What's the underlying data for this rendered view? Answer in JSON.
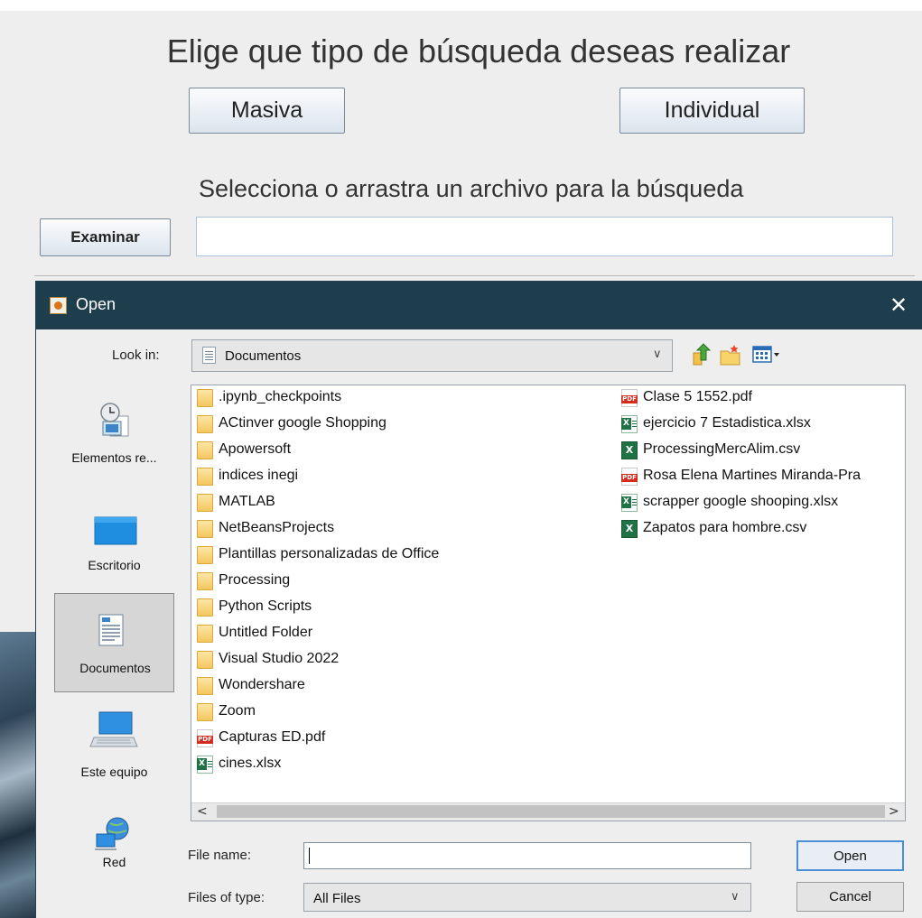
{
  "app": {
    "title": "Elige que tipo de búsqueda deseas realizar",
    "masiva_label": "Masiva",
    "individual_label": "Individual",
    "subtitle": "Selecciona o arrastra un archivo para la búsqueda",
    "examinar_label": "Examinar",
    "path_value": ""
  },
  "dialog": {
    "title": "Open",
    "close_glyph": "✕",
    "look_in_label": "Look in:",
    "look_in_value": "Documentos",
    "places": [
      {
        "label": "Elementos re...",
        "icon": "recent-items-icon"
      },
      {
        "label": "Escritorio",
        "icon": "desktop-icon"
      },
      {
        "label": "Documentos",
        "icon": "documents-icon",
        "selected": true
      },
      {
        "label": "Este equipo",
        "icon": "computer-icon"
      },
      {
        "label": "Red",
        "icon": "network-icon"
      }
    ],
    "files_col1": [
      {
        "name": ".ipynb_checkpoints",
        "type": "folder"
      },
      {
        "name": "ACtinver google Shopping",
        "type": "folder"
      },
      {
        "name": "Apowersoft",
        "type": "folder"
      },
      {
        "name": "indices inegi",
        "type": "folder"
      },
      {
        "name": "MATLAB",
        "type": "folder"
      },
      {
        "name": "NetBeansProjects",
        "type": "folder"
      },
      {
        "name": "Plantillas personalizadas de Office",
        "type": "folder"
      },
      {
        "name": "Processing",
        "type": "folder"
      },
      {
        "name": "Python Scripts",
        "type": "folder"
      },
      {
        "name": "Untitled Folder",
        "type": "folder"
      },
      {
        "name": "Visual Studio 2022",
        "type": "folder"
      },
      {
        "name": "Wondershare",
        "type": "folder"
      },
      {
        "name": "Zoom",
        "type": "folder"
      },
      {
        "name": "Capturas ED.pdf",
        "type": "pdf"
      },
      {
        "name": "cines.xlsx",
        "type": "xlsx"
      }
    ],
    "files_col2": [
      {
        "name": "Clase 5 1552.pdf",
        "type": "pdf"
      },
      {
        "name": "ejercicio 7 Estadistica.xlsx",
        "type": "xlsx"
      },
      {
        "name": "ProcessingMercAlim.csv",
        "type": "csv"
      },
      {
        "name": "Rosa Elena Martines Miranda-Pra",
        "type": "pdf"
      },
      {
        "name": "scrapper google shooping.xlsx",
        "type": "xlsx"
      },
      {
        "name": "Zapatos para hombre.csv",
        "type": "csv"
      }
    ],
    "file_name_label": "File name:",
    "file_name_value": "",
    "files_of_type_label": "Files of type:",
    "files_of_type_value": "All Files",
    "open_label": "Open",
    "cancel_label": "Cancel",
    "scroll_left": "<",
    "scroll_right": ">",
    "chevron": "∨",
    "colors": {
      "titlebar": "#1e3d4d",
      "focus": "#4a8fd6"
    }
  }
}
